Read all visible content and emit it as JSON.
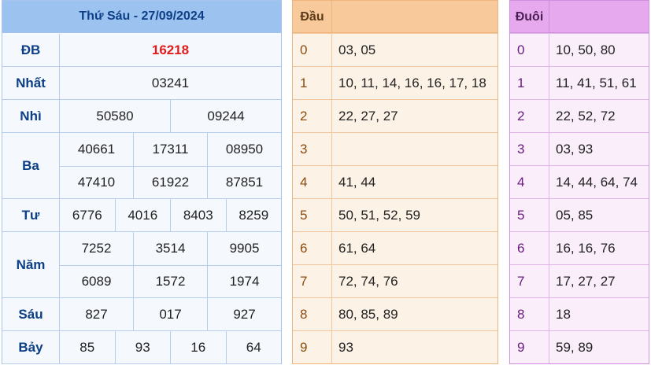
{
  "results": {
    "title": "Thứ Sáu - 27/09/2024",
    "prizes": [
      {
        "label": "ĐB",
        "lines": [
          [
            "16218"
          ]
        ]
      },
      {
        "label": "Nhất",
        "lines": [
          [
            "03241"
          ]
        ]
      },
      {
        "label": "Nhì",
        "lines": [
          [
            "50580",
            "09244"
          ]
        ]
      },
      {
        "label": "Ba",
        "lines": [
          [
            "40661",
            "17311",
            "08950"
          ],
          [
            "47410",
            "61922",
            "87851"
          ]
        ]
      },
      {
        "label": "Tư",
        "lines": [
          [
            "6776",
            "4016",
            "8403",
            "8259"
          ]
        ]
      },
      {
        "label": "Năm",
        "lines": [
          [
            "7252",
            "3514",
            "9905"
          ],
          [
            "6089",
            "1572",
            "1974"
          ]
        ]
      },
      {
        "label": "Sáu",
        "lines": [
          [
            "827",
            "017",
            "927"
          ]
        ]
      },
      {
        "label": "Bảy",
        "lines": [
          [
            "85",
            "93",
            "16",
            "64"
          ]
        ]
      }
    ]
  },
  "dau": {
    "title": "Đầu",
    "rows": [
      {
        "key": "0",
        "values": "03, 05"
      },
      {
        "key": "1",
        "values": "10, 11, 14, 16, 16, 17, 18"
      },
      {
        "key": "2",
        "values": "22, 27, 27"
      },
      {
        "key": "3",
        "values": ""
      },
      {
        "key": "4",
        "values": "41, 44"
      },
      {
        "key": "5",
        "values": "50, 51, 52, 59"
      },
      {
        "key": "6",
        "values": "61, 64"
      },
      {
        "key": "7",
        "values": "72, 74, 76"
      },
      {
        "key": "8",
        "values": "80, 85, 89"
      },
      {
        "key": "9",
        "values": "93"
      }
    ]
  },
  "duoi": {
    "title": "Đuôi",
    "rows": [
      {
        "key": "0",
        "values": "10, 50, 80"
      },
      {
        "key": "1",
        "values": "11, 41, 51, 61"
      },
      {
        "key": "2",
        "values": "22, 52, 72"
      },
      {
        "key": "3",
        "values": "03, 93"
      },
      {
        "key": "4",
        "values": "14, 44, 64, 74"
      },
      {
        "key": "5",
        "values": "05, 85"
      },
      {
        "key": "6",
        "values": "16, 16, 76"
      },
      {
        "key": "7",
        "values": "17, 27, 27"
      },
      {
        "key": "8",
        "values": "18"
      },
      {
        "key": "9",
        "values": "59, 89"
      }
    ]
  },
  "colors": {
    "special_prize": "#e21b1b",
    "results_header": "#9cc2f0",
    "dau_header": "#f7c99b",
    "duoi_header": "#e6a9ee"
  }
}
